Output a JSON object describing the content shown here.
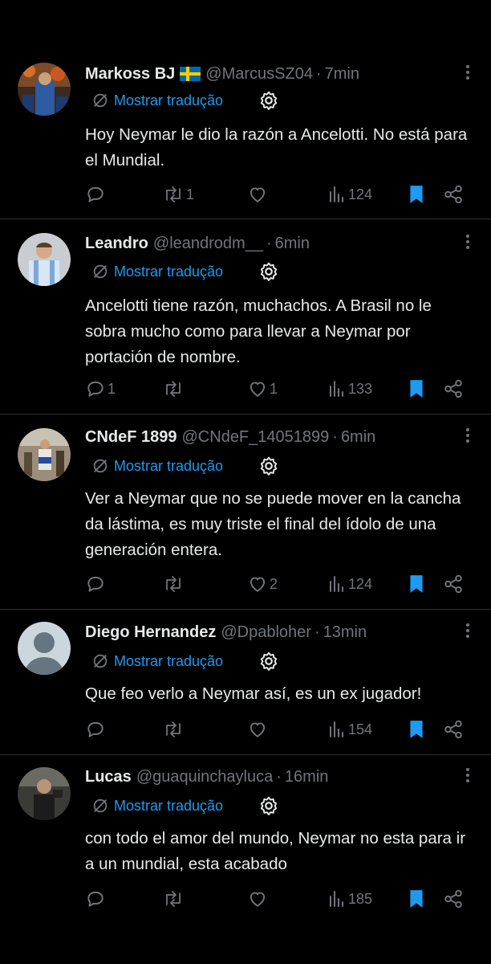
{
  "translate_label": "Mostrar tradução",
  "tweets": [
    {
      "name": "Markoss BJ",
      "handle": "@MarcusSZ04",
      "separator": "·",
      "time": "7min",
      "text": "Hoy Neymar le dio la razón a Ancelotti. No está para el Mundial.",
      "replies": "",
      "retweets": "1",
      "likes": "",
      "views": "124"
    },
    {
      "name": "Leandro",
      "handle": "@leandrodm__",
      "separator": "·",
      "time": "6min",
      "text": "Ancelotti tiene razón, muchachos. A Brasil no le sobra mucho como para llevar a Neymar por portación de nombre.",
      "replies": "1",
      "retweets": "",
      "likes": "1",
      "views": "133"
    },
    {
      "name": "CNdeF 1899",
      "handle": "@CNdeF_14051899",
      "separator": "·",
      "time": "6min",
      "text": "Ver a Neymar que no se puede mover en la cancha da lástima, es muy triste el final del ídolo de una generación entera.",
      "replies": "",
      "retweets": "",
      "likes": "2",
      "views": "124"
    },
    {
      "name": "Diego Hernandez",
      "handle": "@Dpabloher",
      "separator": "·",
      "time": "13min",
      "text": "Que feo verlo a Neymar así, es un ex jugador!",
      "replies": "",
      "retweets": "",
      "likes": "",
      "views": "154"
    },
    {
      "name": "Lucas",
      "handle": "@guaquinchayluca",
      "separator": "·",
      "time": "16min",
      "text": "con todo el amor del mundo, Neymar no esta para ir a un mundial, esta acabado",
      "replies": "",
      "retweets": "",
      "likes": "",
      "views": "185"
    }
  ],
  "colors": {
    "background": "#000000",
    "text": "#e7e9ea",
    "secondary": "#71767b",
    "accent": "#1d9bf0",
    "divider": "#2f3336"
  },
  "icons": [
    "reply-icon",
    "retweet-icon",
    "like-icon",
    "views-icon",
    "bookmark-icon",
    "share-icon",
    "translate-icon",
    "gear-icon",
    "more-icon",
    "sweden-flag-icon"
  ]
}
